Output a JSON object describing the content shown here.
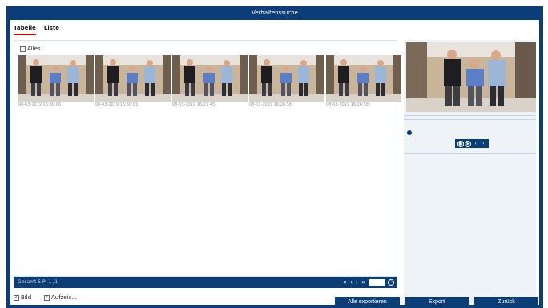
{
  "window": {
    "title": "Verhaltenssuche"
  },
  "tabs": [
    {
      "label": "Tabelle",
      "active": true
    },
    {
      "label": "Liste",
      "active": false
    }
  ],
  "select_all": {
    "label": "Alles",
    "checked": false
  },
  "thumbnails": [
    {
      "timestamp": "08-03-2019 16:30:06"
    },
    {
      "timestamp": "08-03-2019 16:30:03"
    },
    {
      "timestamp": "08-03-2019 16:27:43"
    },
    {
      "timestamp": "08-03-2019 16:26:58"
    },
    {
      "timestamp": "08-03-2019 16:26:58"
    }
  ],
  "pager": {
    "total": "Gesamt 5 P: 1 /1",
    "first": "«",
    "prev": "‹",
    "next": "›",
    "last": "»",
    "go": "→"
  },
  "playback": {
    "stop": "■",
    "play": "▶",
    "prev": "‹",
    "next": "›"
  },
  "options": {
    "bild": {
      "label": "Bild",
      "checked": true
    },
    "aufzeichnung": {
      "label": "Aufzeic...",
      "checked": true
    }
  },
  "buttons": {
    "export_all": "Alle exportieren",
    "export": "Export",
    "back": "Zurück"
  },
  "colors": {
    "accent": "#0b3e77",
    "active_tab": "#d40000"
  }
}
